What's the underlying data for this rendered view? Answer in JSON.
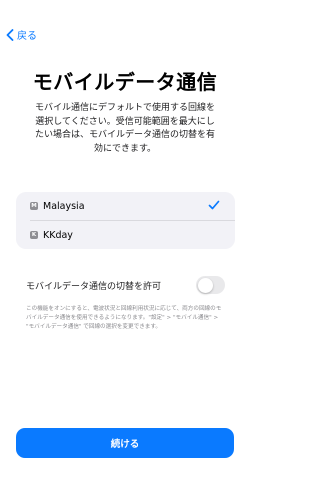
{
  "nav": {
    "back_label": "戻る"
  },
  "header": {
    "title": "モバイルデータ通信",
    "description": "モバイル通信にデフォルトで使用する回線を選択してください。受信可能範囲を最大にしたい場合は、モバイルデータ通信の切替を有効にできます。"
  },
  "lines": {
    "items": [
      {
        "badge": "M",
        "label": "Malaysia",
        "selected": true
      },
      {
        "badge": "K",
        "label": "KKday",
        "selected": false
      }
    ]
  },
  "switching": {
    "label": "モバイルデータ通信の切替を許可",
    "enabled": false,
    "footnote": "この機能をオンにすると、電波状況と回線利用状況に応じて、両方の回線のモバイルデータ通信を使用できるようになります。\"設定\" > \"モバイル通信\" > \"モバイルデータ通信\" で回線の選択を変更できます。"
  },
  "actions": {
    "continue_label": "続ける"
  },
  "colors": {
    "accent": "#0a7aff",
    "switch_off": "#e9e9eb",
    "list_bg": "#f2f2f7"
  }
}
